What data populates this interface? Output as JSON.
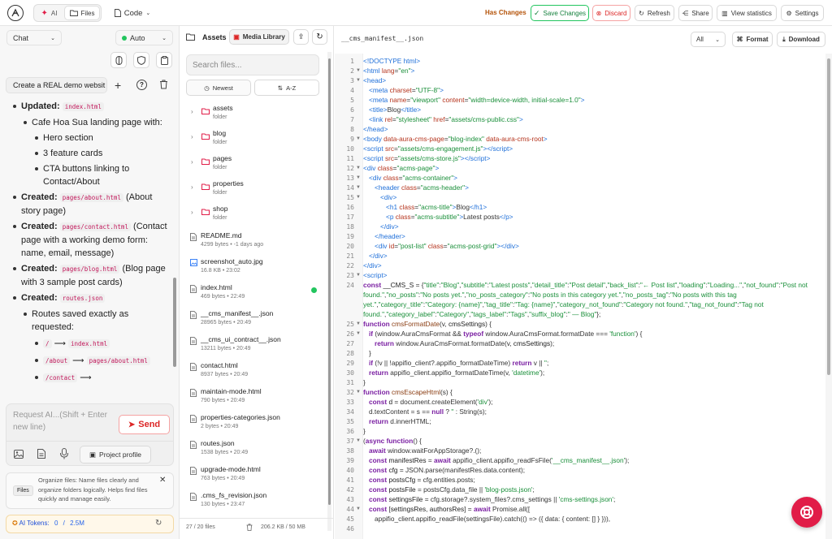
{
  "top": {
    "tabs": [
      "AI",
      "Files"
    ],
    "code_menu": "Code",
    "has_changes": "Has Changes",
    "save_changes": "Save Changes",
    "discard": "Discard",
    "refresh": "Refresh",
    "share": "Share",
    "view_statistics": "View statistics",
    "settings": "Settings"
  },
  "left": {
    "mode_select": "Chat",
    "auto_select": "Auto",
    "session_title": "Create a REAL demo websit",
    "chat": {
      "items": [
        {
          "label": "Updated:",
          "code": "index.html"
        },
        {
          "label": "Cafe Hoa Sua landing page with:"
        },
        {
          "label": "Hero section"
        },
        {
          "label": "3 feature cards"
        },
        {
          "label": "CTA buttons linking to Contact/About"
        },
        {
          "label": "Created:",
          "code": "pages/about.html",
          "text": "(About story page)"
        },
        {
          "label": "Created:",
          "code": "pages/contact.html",
          "text": "(Contact page with a working demo form: name, email, message)"
        },
        {
          "label": "Created:",
          "code": "pages/blog.html",
          "text": "(Blog page with 3 sample post cards)"
        },
        {
          "label": "Created:",
          "code": "routes.json"
        },
        {
          "label": "Routes saved exactly as requested:"
        },
        {
          "from": "/",
          "to": "index.html"
        },
        {
          "from": "/about",
          "to": "pages/about.html"
        },
        {
          "from": "/contact",
          "to": ""
        }
      ],
      "arrow": "⟶"
    },
    "input_placeholder": "Request AI...(Shift + Enter new line)",
    "send": "Send",
    "project_profile": "Project profile",
    "tip_tag": "Files",
    "tip_text": "Organize files: Name files clearly and organize folders logically. Helps find files quickly and manage easily.",
    "tokens_label": "AI Tokens:",
    "tokens_used": "0",
    "tokens_sep": "/",
    "tokens_total": "2.5M"
  },
  "mid": {
    "assets_label": "Assets",
    "media_library": "Media Library",
    "search_placeholder": "Search files...",
    "sort_newest": "Newest",
    "sort_az": "A-Z",
    "folders": [
      {
        "name": "assets",
        "meta": "folder"
      },
      {
        "name": "blog",
        "meta": "folder"
      },
      {
        "name": "pages",
        "meta": "folder"
      },
      {
        "name": "properties",
        "meta": "folder"
      },
      {
        "name": "shop",
        "meta": "folder"
      }
    ],
    "files": [
      {
        "name": "README.md",
        "meta": "4299 bytes • -1 days ago",
        "icon": "doc"
      },
      {
        "name": "screenshot_auto.jpg",
        "meta": "16.8 KB • 23:02",
        "icon": "image"
      },
      {
        "name": "index.html",
        "meta": "469 bytes • 22:49",
        "icon": "doc",
        "status": "#22c55e"
      },
      {
        "name": "__cms_manifest__.json",
        "meta": "28965 bytes • 20:49",
        "icon": "doc"
      },
      {
        "name": "__cms_ui_contract__.json",
        "meta": "13211 bytes • 20:49",
        "icon": "doc"
      },
      {
        "name": "contact.html",
        "meta": "8937 bytes • 20:49",
        "icon": "doc"
      },
      {
        "name": "maintain-mode.html",
        "meta": "790 bytes • 20:49",
        "icon": "doc"
      },
      {
        "name": "properties-categories.json",
        "meta": "2 bytes • 20:49",
        "icon": "doc"
      },
      {
        "name": "routes.json",
        "meta": "1538 bytes • 20:49",
        "icon": "doc"
      },
      {
        "name": "upgrade-mode.html",
        "meta": "763 bytes • 20:49",
        "icon": "doc"
      },
      {
        "name": ".cms_fs_revision.json",
        "meta": "130 bytes • 23:47",
        "icon": "doc"
      }
    ],
    "footer_count": "27 / 20 files",
    "footer_size": "206.2 KB / 50 MB"
  },
  "editor": {
    "filename": "__cms_manifest__.json",
    "filter": "All",
    "format": "Format",
    "download": "Download"
  }
}
